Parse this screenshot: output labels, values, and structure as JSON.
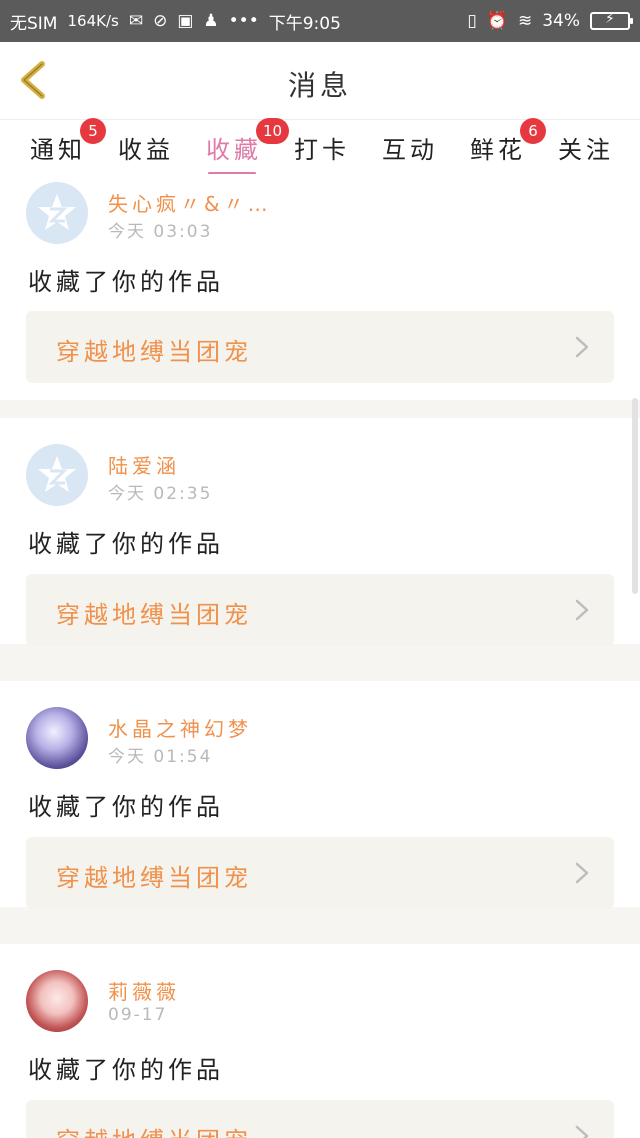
{
  "statusbar": {
    "carrier": "无SIM",
    "speed": "164K/s",
    "time": "下午9:05",
    "battery": "34%"
  },
  "header": {
    "title": "消息"
  },
  "tabs": [
    {
      "label": "通知",
      "badge": "5"
    },
    {
      "label": "收益",
      "badge": ""
    },
    {
      "label": "收藏",
      "badge": "10",
      "active": true
    },
    {
      "label": "打卡",
      "badge": ""
    },
    {
      "label": "互动",
      "badge": ""
    },
    {
      "label": "鲜花",
      "badge": "6"
    },
    {
      "label": "关注",
      "badge": ""
    }
  ],
  "feed": [
    {
      "user": "失心疯〃&〃…",
      "time": "今天 03:03",
      "action": "收藏了你的作品",
      "work": "穿越地缚当团宠",
      "avatar": "default-avatar"
    },
    {
      "user": "陆爱涵",
      "time": "今天 02:35",
      "action": "收藏了你的作品",
      "work": "穿越地缚当团宠",
      "avatar": "default-avatar"
    },
    {
      "user": "水晶之神幻梦",
      "time": "今天 01:54",
      "action": "收藏了你的作品",
      "work": "穿越地缚当团宠",
      "avatar": "photo-avatar"
    },
    {
      "user": "莉薇薇",
      "time": "09-17",
      "action": "收藏了你的作品",
      "work": "穿越地缚当团宠",
      "avatar": "photo-avatar"
    }
  ],
  "colors": {
    "accent_orange": "#f0914c",
    "tab_active_pink": "#e07aa8",
    "badge_red": "#e6393f",
    "back_yellow": "#d7b13f"
  }
}
